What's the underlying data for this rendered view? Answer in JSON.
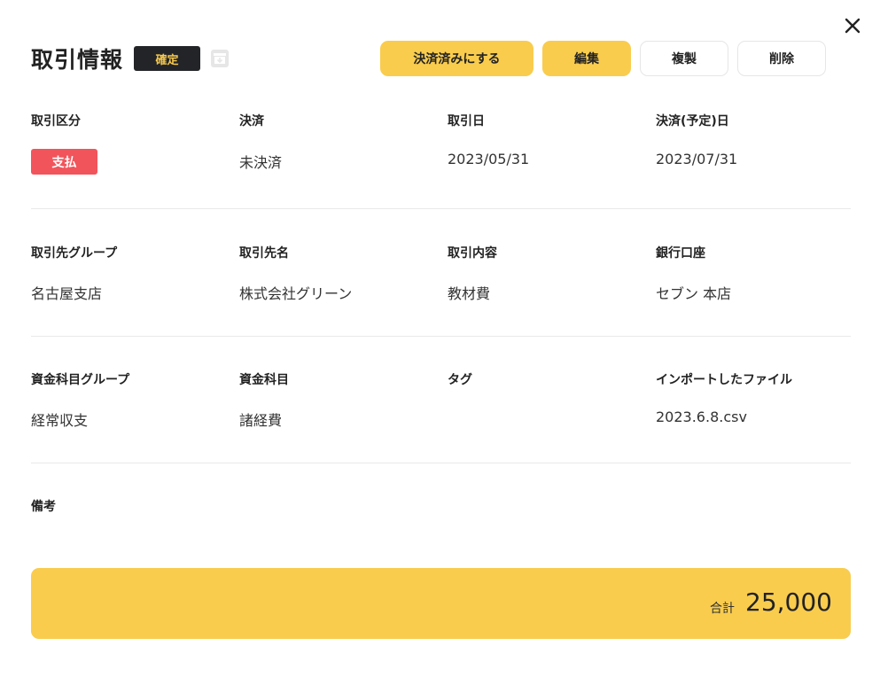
{
  "header": {
    "title": "取引情報",
    "status_badge": "確定"
  },
  "actions": {
    "settle_label": "決済済みにする",
    "edit_label": "編集",
    "copy_label": "複製",
    "delete_label": "削除"
  },
  "fields": {
    "row1": {
      "type": {
        "label": "取引区分",
        "value": "支払"
      },
      "settlement": {
        "label": "決済",
        "value": "未決済"
      },
      "transaction_date": {
        "label": "取引日",
        "value": "2023/05/31"
      },
      "settlement_date": {
        "label": "決済(予定)日",
        "value": "2023/07/31"
      }
    },
    "row2": {
      "partner_group": {
        "label": "取引先グループ",
        "value": "名古屋支店"
      },
      "partner_name": {
        "label": "取引先名",
        "value": "株式会社グリーン"
      },
      "content": {
        "label": "取引内容",
        "value": "教材費"
      },
      "bank_account": {
        "label": "銀行口座",
        "value": "セブン 本店"
      }
    },
    "row3": {
      "fund_group": {
        "label": "資金科目グループ",
        "value": "経常収支"
      },
      "fund_item": {
        "label": "資金科目",
        "value": "諸経費"
      },
      "tag": {
        "label": "タグ",
        "value": ""
      },
      "imported_file": {
        "label": "インポートしたファイル",
        "value": "2023.6.8.csv"
      }
    },
    "notes": {
      "label": "備考",
      "value": ""
    }
  },
  "total": {
    "label": "合計",
    "value": "25,000"
  },
  "colors": {
    "accent": "#f9cc4e",
    "badge_dark": "#222428",
    "badge_text": "#f8c94d",
    "payment_red": "#f2545b"
  },
  "icons": {
    "close": "close-icon",
    "archive": "archive-icon"
  }
}
